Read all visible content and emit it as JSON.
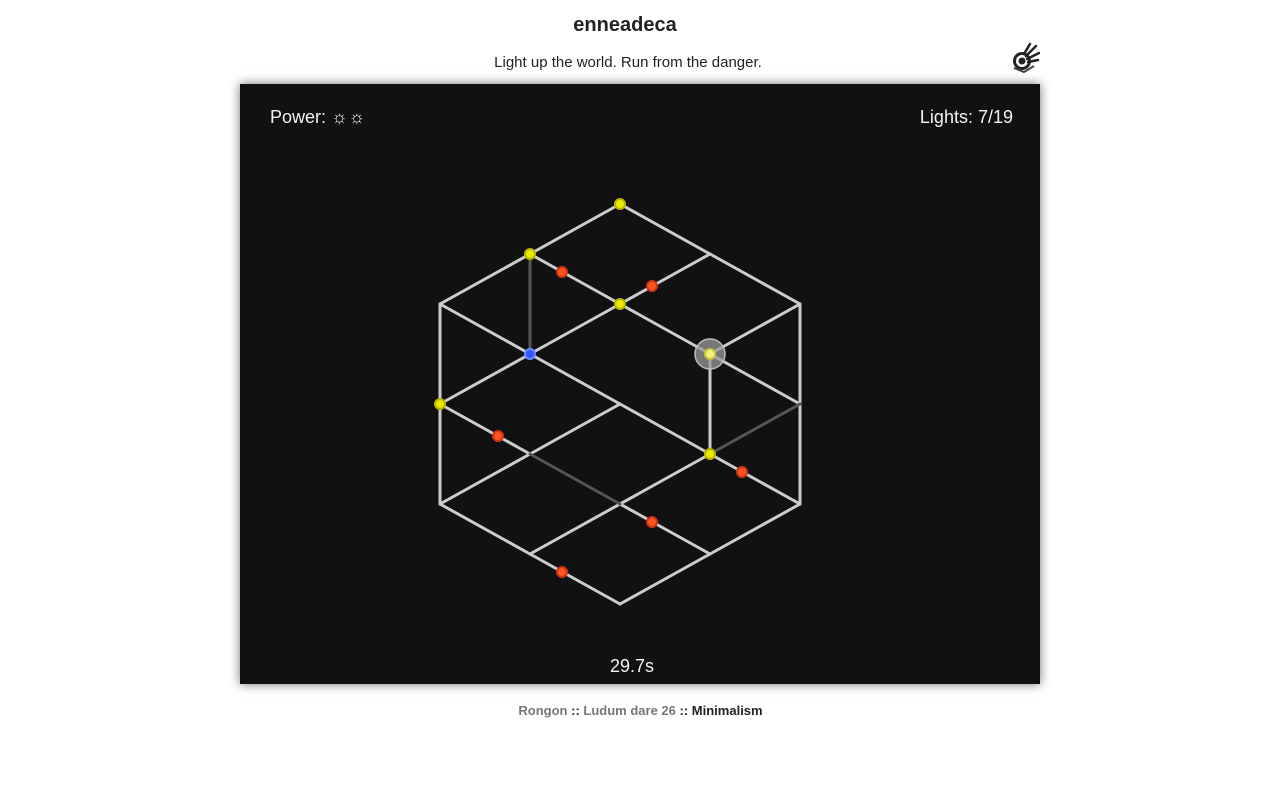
{
  "header": {
    "title": "enneadeca",
    "subtitle": "Light up the world. Run from the danger.",
    "logo_icon": "hand-light-icon"
  },
  "hud": {
    "power_label": "Power:",
    "power_symbols": "☼☼",
    "lights_label": "Lights: 7/19",
    "timer": "29.7s"
  },
  "colors": {
    "canvas_bg": "#111111",
    "edge": "#cccccc",
    "edge_dim": "#555555",
    "light_node": "#e8e800",
    "danger_node": "#ff5522",
    "player_node": "#3355ff",
    "cursor": "#aaaaaa"
  },
  "footer": {
    "author": "Rongon",
    "separator": "::",
    "event": "Ludum dare 26",
    "theme": "Minimalism"
  }
}
